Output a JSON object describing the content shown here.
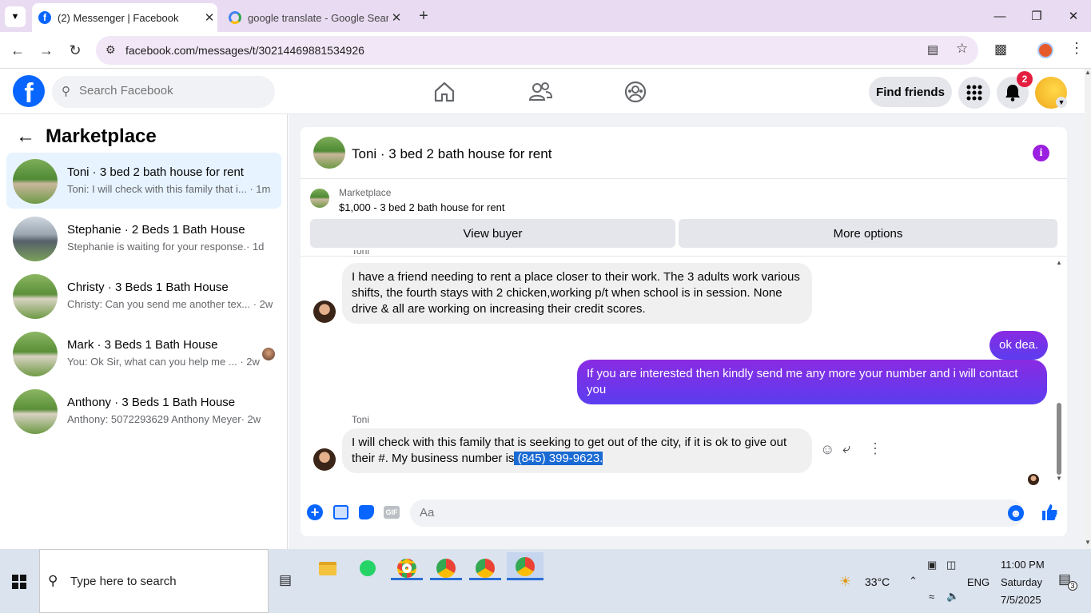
{
  "browser": {
    "tabs": [
      {
        "title": "(2) Messenger | Facebook",
        "active": true
      },
      {
        "title": "google translate - Google Search",
        "active": false
      }
    ],
    "url": "facebook.com/messages/t/30214469881534926"
  },
  "facebook": {
    "search_placeholder": "Search Facebook",
    "find_friends": "Find friends",
    "notification_count": "2",
    "brand_color": "#0866ff"
  },
  "sidebar": {
    "title": "Marketplace",
    "conversations": [
      {
        "name": "Toni · 3 bed 2 bath house for rent",
        "preview": "Toni: I will check with this family that i...",
        "time": "· 1m",
        "selected": true
      },
      {
        "name": "Stephanie · 2 Beds 1 Bath House",
        "preview": "Stephanie is waiting for your response.",
        "time": "· 1d",
        "selected": false
      },
      {
        "name": "Christy · 3 Beds 1 Bath House",
        "preview": "Christy: Can you send me another tex...",
        "time": "· 2w",
        "selected": false
      },
      {
        "name": "Mark · 3 Beds 1 Bath House",
        "preview": "You: Ok Sir, what can you help me ...",
        "time": "· 2w",
        "selected": false
      },
      {
        "name": "Anthony · 3 Beds 1 Bath House",
        "preview": "Anthony: 5072293629 Anthony Meyer",
        "time": "· 2w",
        "selected": false
      }
    ]
  },
  "chat": {
    "title": "Toni · 3 bed 2 bath house for rent",
    "marketplace_label": "Marketplace",
    "listing": "$1,000 - 3 bed 2 bath house for rent",
    "view_buyer": "View buyer",
    "more_options": "More options",
    "sender_top": "Toni",
    "messages": [
      {
        "from": "Toni",
        "text": "I have a friend needing to rent a place closer to their work. The 3 adults work various shifts, the fourth stays with 2 chicken,working p/t when school is in session. None drive & all are working on increasing their credit scores."
      },
      {
        "from": "me",
        "text": "ok dea."
      },
      {
        "from": "me",
        "text": "If you are interested then kindly send me any more your number and i will contact you"
      },
      {
        "from": "Toni",
        "text_before": "I will check with this family that is seeking to get out of the city, if it is ok to give out their #. My business number is",
        "text_highlight": " (845) 399-9623."
      }
    ],
    "sender_label": "Toni",
    "composer_placeholder": "Aa",
    "accent_color": "#6b37f0"
  },
  "taskbar": {
    "search_placeholder": "Type here to search",
    "weather": "33°C",
    "language": "ENG",
    "time": "11:00 PM",
    "day": "Saturday",
    "date": "7/5/2025",
    "notification_count": "3"
  }
}
